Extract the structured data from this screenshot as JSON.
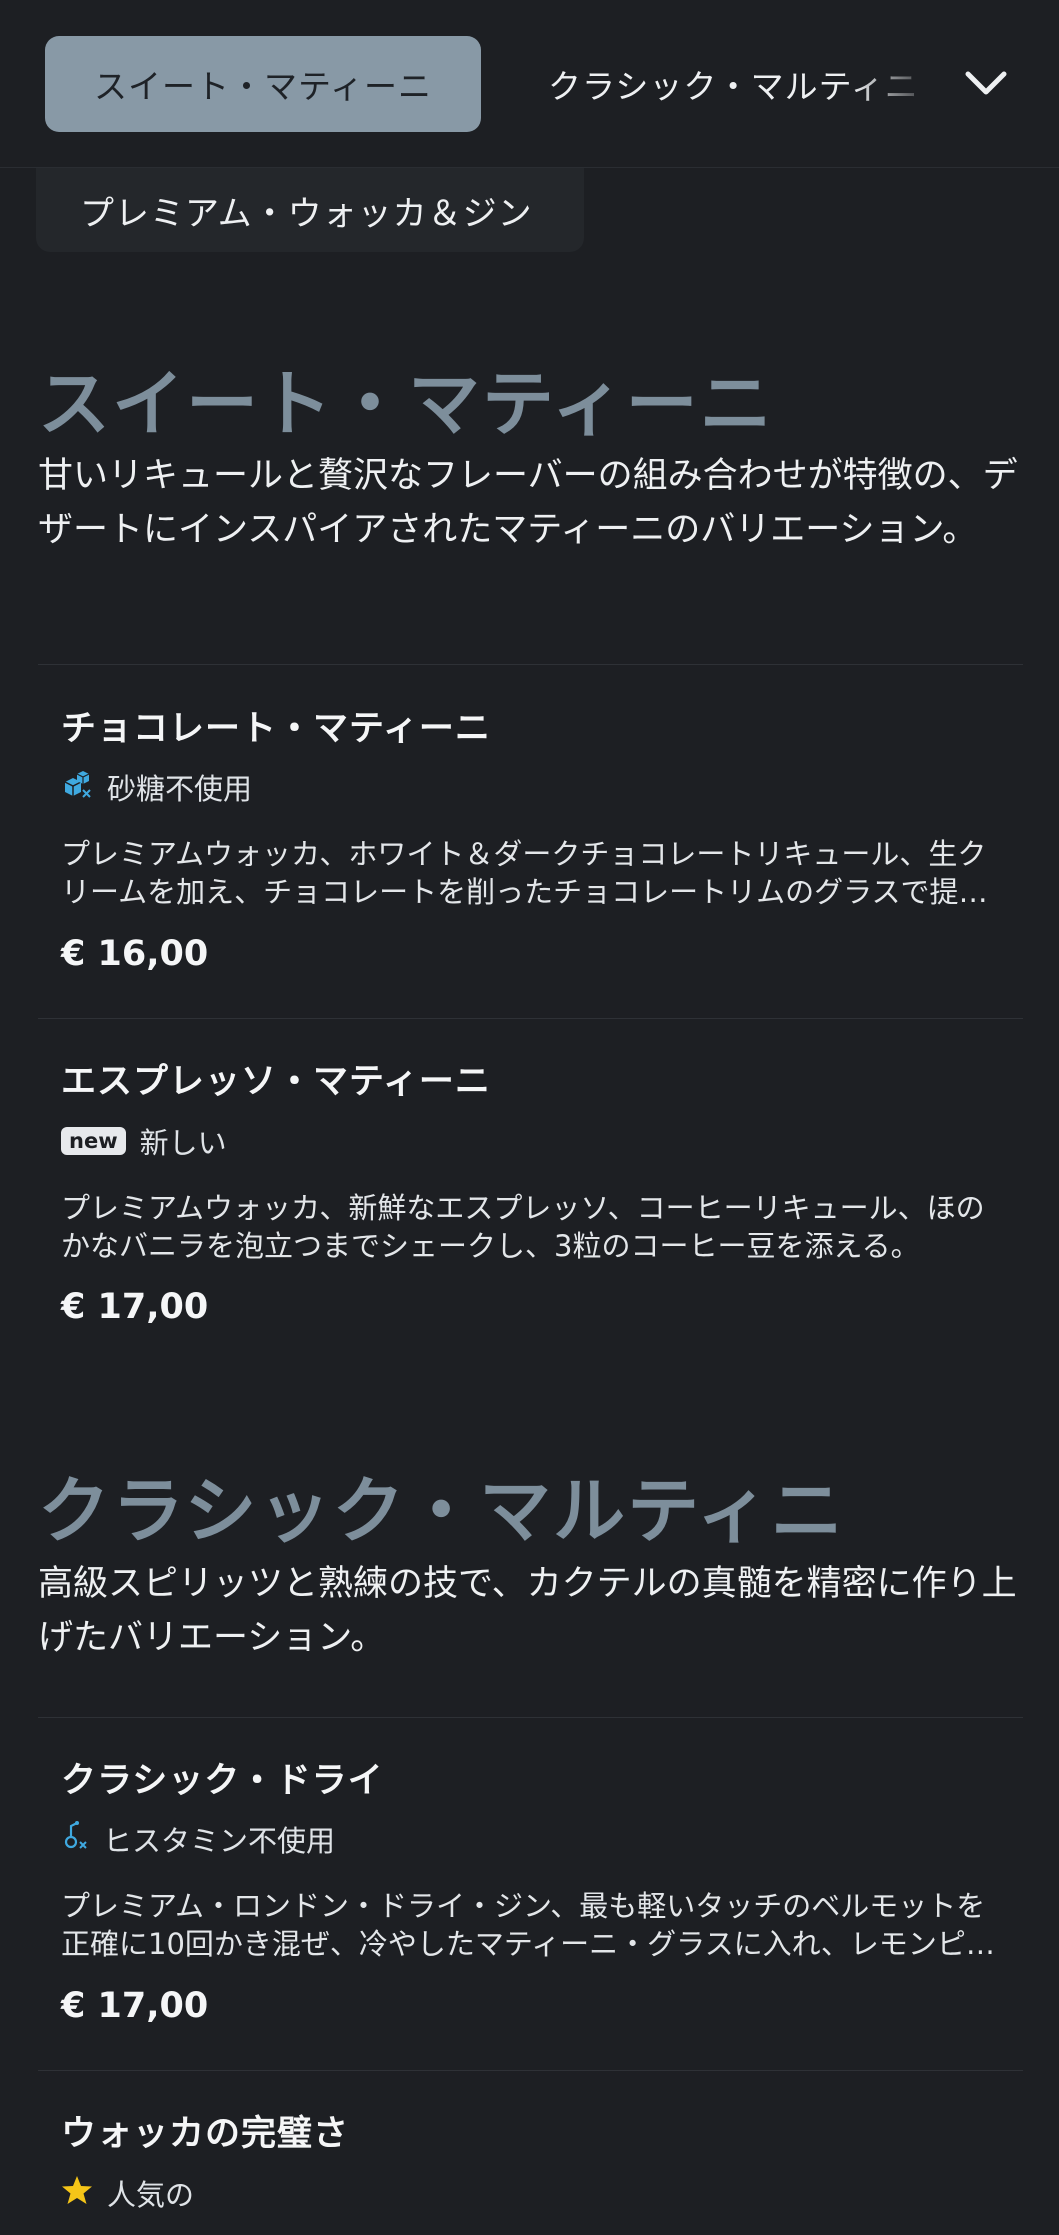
{
  "nav": {
    "tabs": [
      {
        "label": "スイート・マティーニ",
        "active": true
      },
      {
        "label": "クラシック・マルティニ",
        "active": false
      }
    ],
    "overflow_tab": "プレミアム・ウォッカ＆ジン",
    "chevron_icon": "chevron-down-icon"
  },
  "sections": [
    {
      "title": "スイート・マティーニ",
      "description": "甘いリキュールと贅沢なフレーバーの組み合わせが特徴の、デザートにインスパイアされたマティーニのバリエーション。",
      "items": [
        {
          "name": "チョコレート・マティーニ",
          "tag": {
            "icon": "sugar-free-icon",
            "label": "砂糖不使用"
          },
          "description": "プレミアムウォッカ、ホワイト＆ダークチョコレートリキュール、生クリームを加え、チョコレートを削ったチョコレートリムのグラスで提供。",
          "price": "€ 16,00"
        },
        {
          "name": "エスプレッソ・マティーニ",
          "tag": {
            "icon": "new-badge",
            "badge_text": "new",
            "label": "新しい"
          },
          "description": "プレミアムウォッカ、新鮮なエスプレッソ、コーヒーリキュール、ほのかなバニラを泡立つまでシェークし、3粒のコーヒー豆を添える。",
          "price": "€ 17,00"
        }
      ]
    },
    {
      "title": "クラシック・マルティニ",
      "description": "高級スピリッツと熟練の技で、カクテルの真髄を精密に作り上げたバリエーション。",
      "items": [
        {
          "name": "クラシック・ドライ",
          "tag": {
            "icon": "histamine-free-icon",
            "label": "ヒスタミン不使用"
          },
          "description": "プレミアム・ロンドン・ドライ・ジン、最も軽いタッチのベルモットを正確に10回かき混ぜ、冷やしたマティーニ・グラスに入れ、レモンピールを添える。",
          "price": "€ 17,00"
        },
        {
          "name": "ウォッカの完璧さ",
          "tag": {
            "icon": "star-icon",
            "label": "人気の"
          }
        }
      ]
    }
  ],
  "colors": {
    "background": "#1d1f23",
    "active_tab": "#8899a6",
    "section_title": "#7d8e9b",
    "icon_blue": "#3fa9e0",
    "star": "#f5c518"
  }
}
